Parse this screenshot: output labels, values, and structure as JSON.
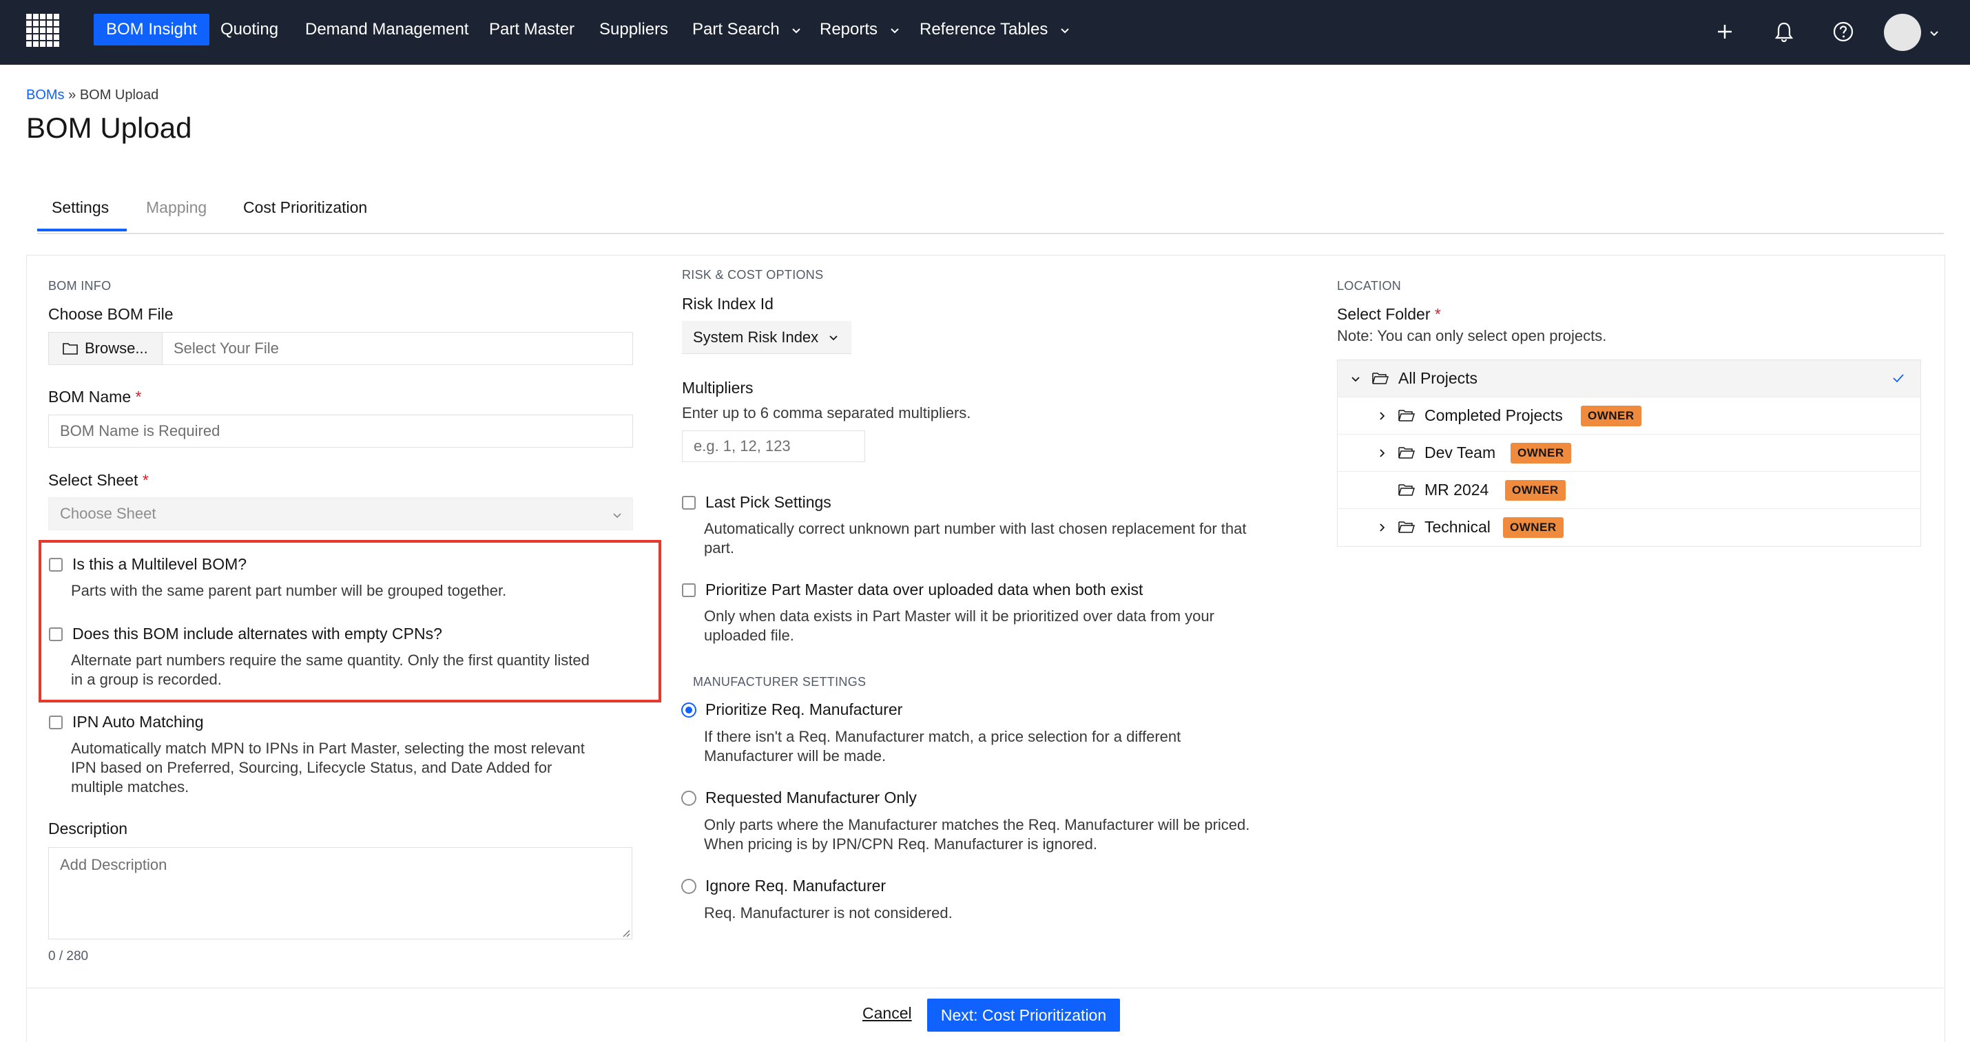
{
  "nav": {
    "items": [
      {
        "label": "BOM Insight",
        "active": true
      },
      {
        "label": "Quoting"
      },
      {
        "label": "Demand Management"
      },
      {
        "label": "Part Master"
      },
      {
        "label": "Suppliers"
      },
      {
        "label": "Part Search",
        "dropdown": true
      },
      {
        "label": "Reports",
        "dropdown": true
      },
      {
        "label": "Reference Tables",
        "dropdown": true
      }
    ],
    "icons": [
      "grid-logo-icon",
      "plus-icon",
      "bell-icon",
      "help-icon",
      "avatar",
      "chevron-down-icon"
    ]
  },
  "breadcrumb": {
    "link": "BOMs",
    "separator": "»",
    "current": "BOM Upload"
  },
  "page_title": "BOM Upload",
  "tabs": [
    {
      "label": "Settings",
      "state": "active"
    },
    {
      "label": "Mapping",
      "state": "disabled"
    },
    {
      "label": "Cost Prioritization",
      "state": "enabled"
    }
  ],
  "bom_info": {
    "section": "BOM INFO",
    "file_label": "Choose BOM File",
    "browse_label": "Browse...",
    "file_placeholder": "Select Your File",
    "name_label": "BOM Name",
    "name_placeholder": "BOM Name is Required",
    "sheet_label": "Select Sheet",
    "sheet_placeholder": "Choose Sheet",
    "required_mark": "*",
    "multilevel_label": "Is this a Multilevel BOM?",
    "multilevel_help": "Parts with the same parent part number will be grouped together.",
    "alternates_label": "Does this BOM include alternates with empty CPNs?",
    "alternates_help_1": "Alternate part numbers require the same quantity. Only the first quantity listed",
    "alternates_help_2": "in a group is recorded.",
    "ipn_label": "IPN Auto Matching",
    "ipn_help_1": "Automatically match MPN to IPNs in Part Master, selecting the most relevant",
    "ipn_help_2": "IPN based on Preferred, Sourcing, Lifecycle Status, and Date Added for",
    "ipn_help_3": "multiple matches.",
    "description_label": "Description",
    "description_placeholder": "Add Description",
    "counter": "0 / 280"
  },
  "risk": {
    "section": "RISK & COST OPTIONS",
    "risk_label": "Risk Index Id",
    "risk_value": "System Risk Index",
    "multipliers_label": "Multipliers",
    "multipliers_help": "Enter up to 6 comma separated multipliers.",
    "multipliers_placeholder": "e.g. 1, 12, 123",
    "last_pick_label": "Last Pick Settings",
    "last_pick_help_1": "Automatically correct unknown part number with last chosen replacement for that",
    "last_pick_help_2": "part.",
    "prioritize_label": "Prioritize Part Master data over uploaded data when both exist",
    "prioritize_help_1": "Only when data exists in Part Master will it be prioritized over data from your",
    "prioritize_help_2": "uploaded file.",
    "mfr_section": "MANUFACTURER SETTINGS",
    "mfr_opt1_label": "Prioritize Req. Manufacturer",
    "mfr_opt1_help_1": "If there isn't a Req. Manufacturer match, a price selection for a different",
    "mfr_opt1_help_2": "Manufacturer will be made.",
    "mfr_opt2_label": "Requested Manufacturer Only",
    "mfr_opt2_help_1": "Only parts where the Manufacturer matches the Req. Manufacturer will be priced.",
    "mfr_opt2_help_2": "When pricing is by IPN/CPN Req. Manufacturer is ignored.",
    "mfr_opt3_label": "Ignore Req. Manufacturer",
    "mfr_opt3_help": "Req. Manufacturer is not considered.",
    "selected_option": "Prioritize Req. Manufacturer"
  },
  "location": {
    "section": "LOCATION",
    "folder_label": "Select Folder",
    "note": "Note: You can only select open projects.",
    "tree": [
      {
        "name": "All Projects",
        "selected": true
      },
      {
        "name": "Completed Projects",
        "badge": "OWNER"
      },
      {
        "name": "Dev Team",
        "badge": "OWNER"
      },
      {
        "name": "MR 2024",
        "badge": "OWNER"
      },
      {
        "name": "Technical",
        "badge": "OWNER"
      }
    ]
  },
  "footer": {
    "cancel": "Cancel",
    "next": "Next: Cost Prioritization"
  },
  "colors": {
    "nav_bg": "#1c2433",
    "accent": "#0f62fe",
    "badge": "#f08a3c",
    "highlight": "#e6392b"
  }
}
